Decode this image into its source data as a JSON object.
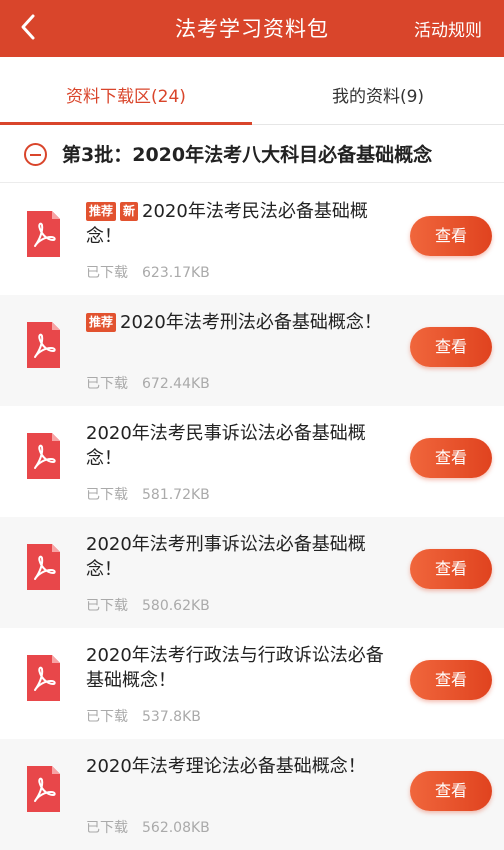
{
  "header": {
    "title": "法考学习资料包",
    "rules_label": "活动规则"
  },
  "tabs": {
    "download": "资料下载区(24)",
    "mine": "我的资料(9)"
  },
  "batch": {
    "title": "第3批：2020年法考八大科目必备基础概念"
  },
  "tags": {
    "recommend": "推荐",
    "new": "新"
  },
  "items": [
    {
      "name": "2020年法考民法必备基础概念！",
      "status": "已下载",
      "size": "623.17KB",
      "button": "查看"
    },
    {
      "name": "2020年法考刑法必备基础概念！",
      "status": "已下载",
      "size": "672.44KB",
      "button": "查看"
    },
    {
      "name": "2020年法考民事诉讼法必备基础概念！",
      "status": "已下载",
      "size": "581.72KB",
      "button": "查看"
    },
    {
      "name": "2020年法考刑事诉讼法必备基础概念！",
      "status": "已下载",
      "size": "580.62KB",
      "button": "查看"
    },
    {
      "name": "2020年法考行政法与行政诉讼法必备基础概念！",
      "status": "已下载",
      "size": "537.8KB",
      "button": "查看"
    },
    {
      "name": "2020年法考理论法必备基础概念！",
      "status": "已下载",
      "size": "562.08KB",
      "button": "查看"
    }
  ],
  "colors": {
    "accent": "#d9452b",
    "button": "#e8502a"
  },
  "icons": {
    "back": "chevron-left-icon",
    "collapse": "minus-circle-icon",
    "file": "pdf-file-icon"
  }
}
